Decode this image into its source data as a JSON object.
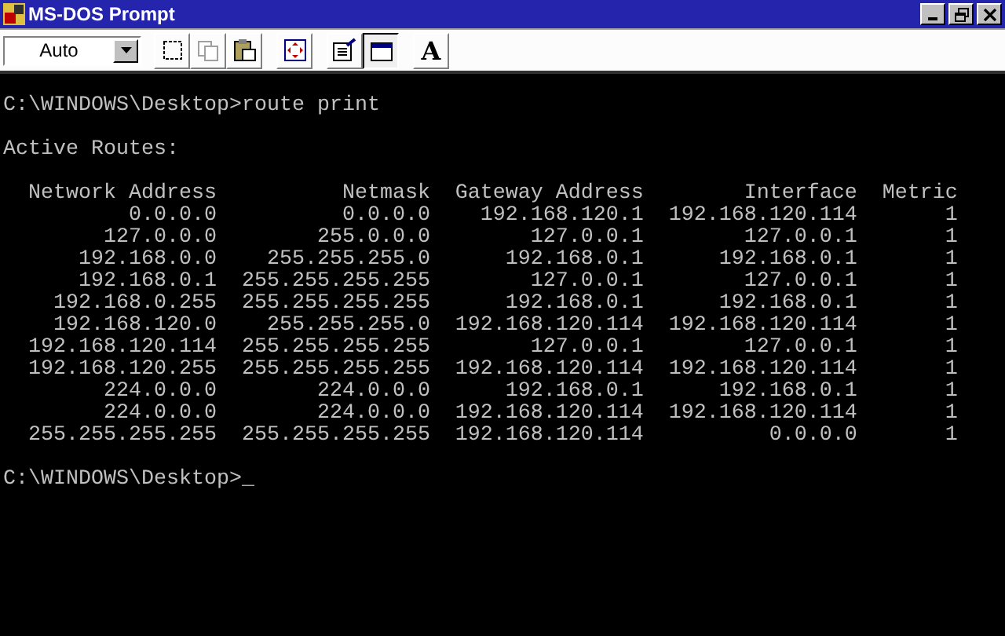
{
  "window": {
    "title": "MS-DOS Prompt"
  },
  "toolbar": {
    "font_size": "Auto",
    "tools": [
      {
        "kind": "mark",
        "selected": false,
        "disabled": false
      },
      {
        "kind": "copy",
        "selected": false,
        "disabled": true
      },
      {
        "kind": "paste",
        "selected": false,
        "disabled": false
      },
      {
        "kind": "fullscreen",
        "selected": false,
        "disabled": false
      },
      {
        "kind": "properties",
        "selected": false,
        "disabled": false
      },
      {
        "kind": "background",
        "selected": true,
        "disabled": false
      },
      {
        "kind": "font",
        "label": "A",
        "selected": false,
        "disabled": false
      }
    ]
  },
  "console": {
    "command_line": "C:\\WINDOWS\\Desktop>route print",
    "heading": "Active Routes:",
    "table": {
      "columns": [
        "Network Address",
        "Netmask",
        "Gateway Address",
        "Interface",
        "Metric"
      ],
      "rows": [
        [
          "0.0.0.0",
          "0.0.0.0",
          "192.168.120.1",
          "192.168.120.114",
          "1"
        ],
        [
          "127.0.0.0",
          "255.0.0.0",
          "127.0.0.1",
          "127.0.0.1",
          "1"
        ],
        [
          "192.168.0.0",
          "255.255.255.0",
          "192.168.0.1",
          "192.168.0.1",
          "1"
        ],
        [
          "192.168.0.1",
          "255.255.255.255",
          "127.0.0.1",
          "127.0.0.1",
          "1"
        ],
        [
          "192.168.0.255",
          "255.255.255.255",
          "192.168.0.1",
          "192.168.0.1",
          "1"
        ],
        [
          "192.168.120.0",
          "255.255.255.0",
          "192.168.120.114",
          "192.168.120.114",
          "1"
        ],
        [
          "192.168.120.114",
          "255.255.255.255",
          "127.0.0.1",
          "127.0.0.1",
          "1"
        ],
        [
          "192.168.120.255",
          "255.255.255.255",
          "192.168.120.114",
          "192.168.120.114",
          "1"
        ],
        [
          "224.0.0.0",
          "224.0.0.0",
          "192.168.0.1",
          "192.168.0.1",
          "1"
        ],
        [
          "224.0.0.0",
          "224.0.0.0",
          "192.168.120.114",
          "192.168.120.114",
          "1"
        ],
        [
          "255.255.255.255",
          "255.255.255.255",
          "192.168.120.114",
          "0.0.0.0",
          "1"
        ]
      ]
    },
    "prompt": "C:\\WINDOWS\\Desktop>",
    "cursor": "_"
  }
}
